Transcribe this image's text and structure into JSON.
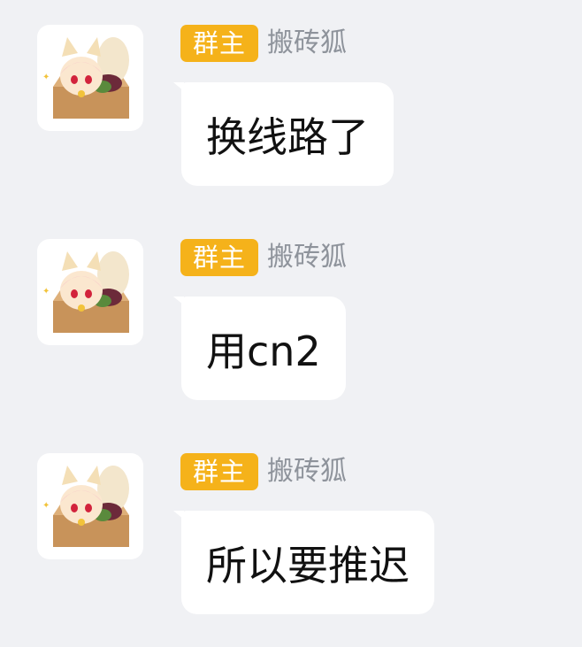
{
  "messages": [
    {
      "role_badge": "群主",
      "sender": "搬砖狐",
      "text": "换线路了",
      "avatar_icon": "fox-girl-in-box-avatar"
    },
    {
      "role_badge": "群主",
      "sender": "搬砖狐",
      "text": "用cn2",
      "avatar_icon": "fox-girl-in-box-avatar"
    },
    {
      "role_badge": "群主",
      "sender": "搬砖狐",
      "text": "所以要推迟",
      "avatar_icon": "fox-girl-in-box-avatar"
    }
  ],
  "colors": {
    "background": "#f0f1f4",
    "badge": "#f5b21a",
    "sender_name": "#8e939b",
    "bubble": "#ffffff"
  }
}
